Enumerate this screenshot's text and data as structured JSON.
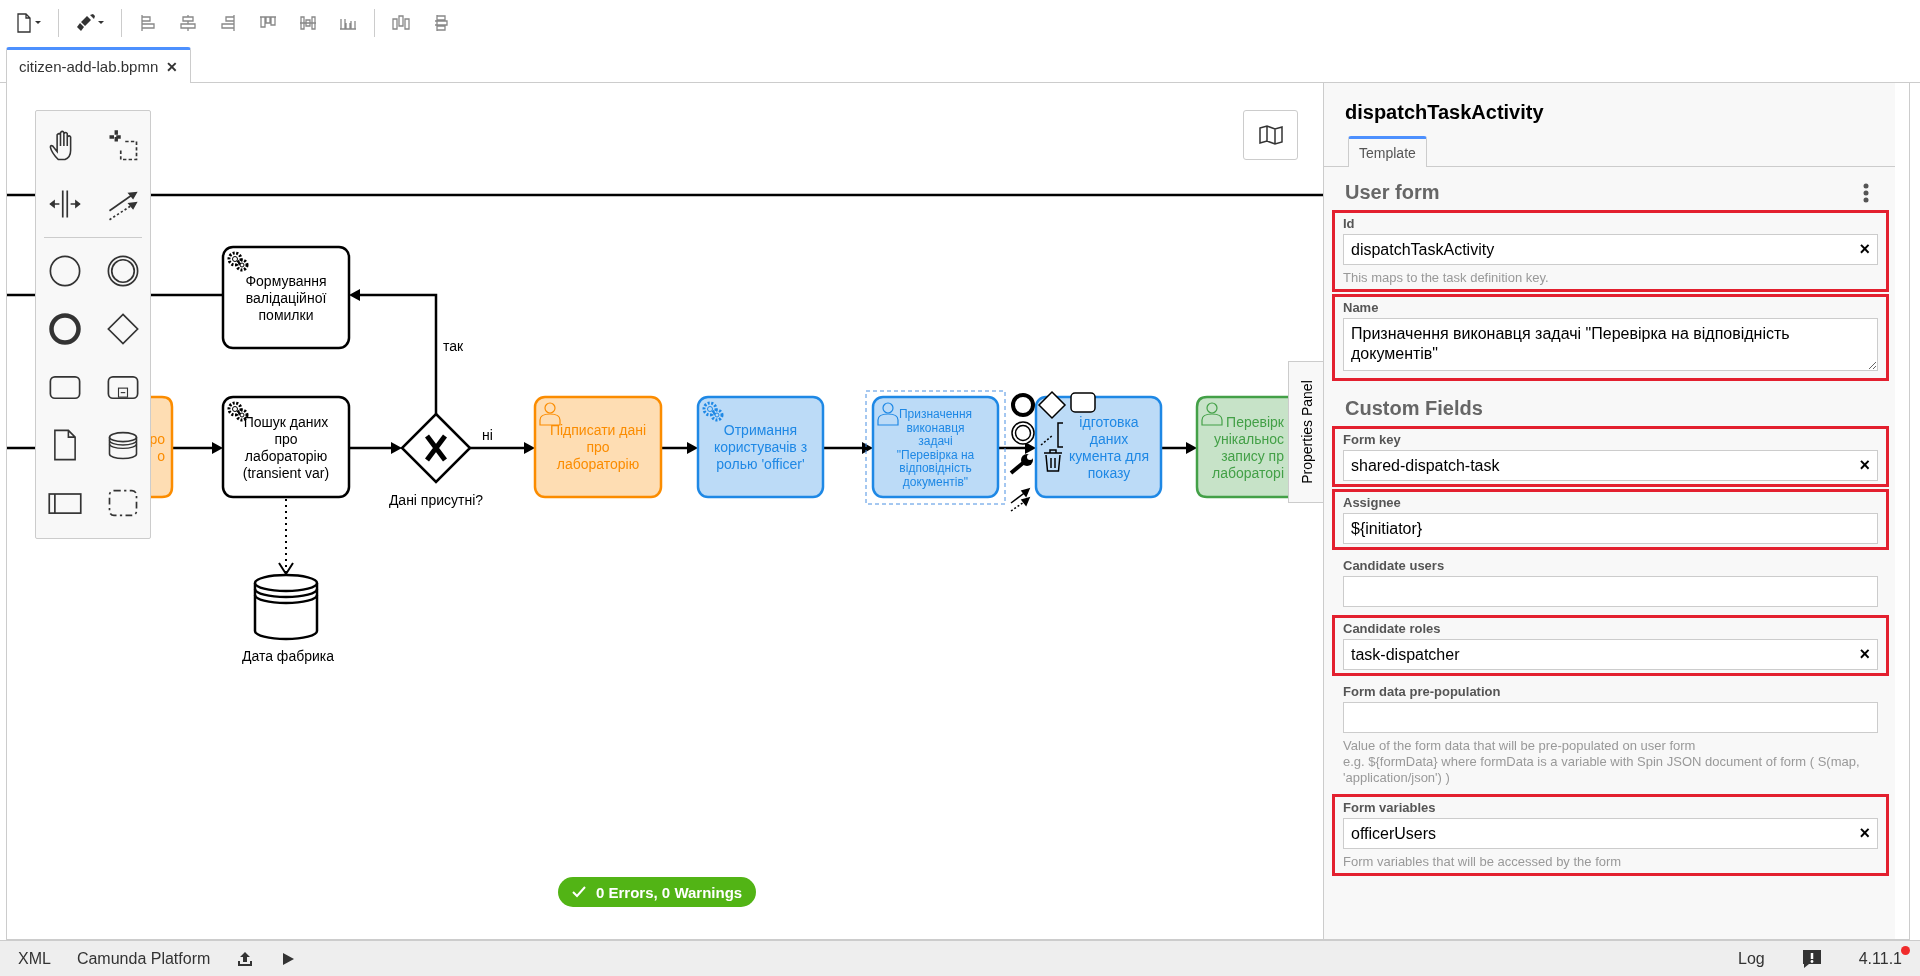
{
  "tabs": [
    {
      "label": "citizen-add-lab.bpmn",
      "close": "✕",
      "selected": true
    }
  ],
  "diagram": {
    "tasks": [
      {
        "kind": "none",
        "color": "#fb8c00",
        "selected": false,
        "lines": [
          "ро",
          "о"
        ]
      },
      {
        "kind": "service",
        "color": "#000000",
        "selected": false,
        "lines": [
          "Формування",
          "валідаційної",
          "помилки"
        ]
      },
      {
        "kind": "service",
        "color": "#000000",
        "selected": false,
        "lines": [
          "Пошук даних",
          "про",
          "лабораторію",
          "(transient var)"
        ]
      },
      {
        "kind": "user",
        "color": "#fb8c00",
        "selected": false,
        "lines": [
          "Підписати дані",
          "про",
          "лабораторію"
        ]
      },
      {
        "kind": "service",
        "color": "#1e88e5",
        "selected": false,
        "lines": [
          "Отримання",
          "користувачів з",
          "ролью 'officer'"
        ]
      },
      {
        "kind": "user",
        "color": "#1e88e5",
        "selected": true,
        "lines": [
          "Призначення",
          "виконавця",
          "задачі",
          "\"Перевірка на",
          "відповідність",
          "документів\""
        ]
      },
      {
        "kind": "none",
        "color": "#1e88e5",
        "selected": false,
        "lines": [
          "ідготовка",
          "даних",
          "кумента для",
          "показу"
        ]
      },
      {
        "kind": "user",
        "color": "#43a047",
        "selected": false,
        "lines": [
          "Перевірк",
          "унікальнос",
          "запису пр",
          "лабораторі"
        ]
      }
    ],
    "gateway": {
      "label": "Дані присутні?"
    },
    "flow_labels": [
      "так",
      "ні"
    ],
    "data_store": {
      "label": "Дата фабрика"
    }
  },
  "validation_badge": {
    "text": "0 Errors, 0 Warnings"
  },
  "properties_tab": {
    "label": "Properties Panel"
  },
  "properties_panel": {
    "title": "dispatchTaskActivity",
    "tabs": [
      {
        "label": "Template",
        "selected": true
      }
    ],
    "groups": [
      {
        "title": "User form",
        "menu": true,
        "fields": [
          {
            "kind": "input",
            "label": "Id",
            "value": "dispatchTaskActivity",
            "clear": "×",
            "description": [
              "This maps to the task definition key."
            ],
            "highlighted": true
          },
          {
            "kind": "textarea",
            "label": "Name",
            "value": "Призначення виконавця задачі \"Перевірка на відповідність документів\"",
            "highlighted": true
          }
        ]
      },
      {
        "title": "Custom Fields",
        "menu": false,
        "fields": [
          {
            "kind": "input",
            "label": "Form key",
            "value": "shared-dispatch-task",
            "clear": "×",
            "highlighted": true
          },
          {
            "kind": "input",
            "label": "Assignee",
            "value": "${initiator}",
            "highlighted": true
          },
          {
            "kind": "input",
            "label": "Candidate users",
            "highlighted": false
          },
          {
            "kind": "input",
            "label": "Candidate roles",
            "value": "task-dispatcher",
            "clear": "×",
            "highlighted": true
          },
          {
            "kind": "input",
            "label": "Form data pre-population",
            "description": [
              "Value of the form data that will be pre-populated on user form",
              "e.g. ${formData} where formData is a variable with Spin JSON document of form ( S(map, 'application/json') )"
            ],
            "highlighted": false
          },
          {
            "kind": "input",
            "label": "Form variables",
            "value": "officerUsers",
            "clear": "×",
            "description": [
              "Form variables that will be accessed by the form"
            ],
            "highlighted": true
          }
        ]
      }
    ]
  },
  "status_bar": {
    "left": [
      "XML",
      "Camunda Platform"
    ],
    "log": "Log",
    "version": "4.11.1",
    "update_available": true
  }
}
